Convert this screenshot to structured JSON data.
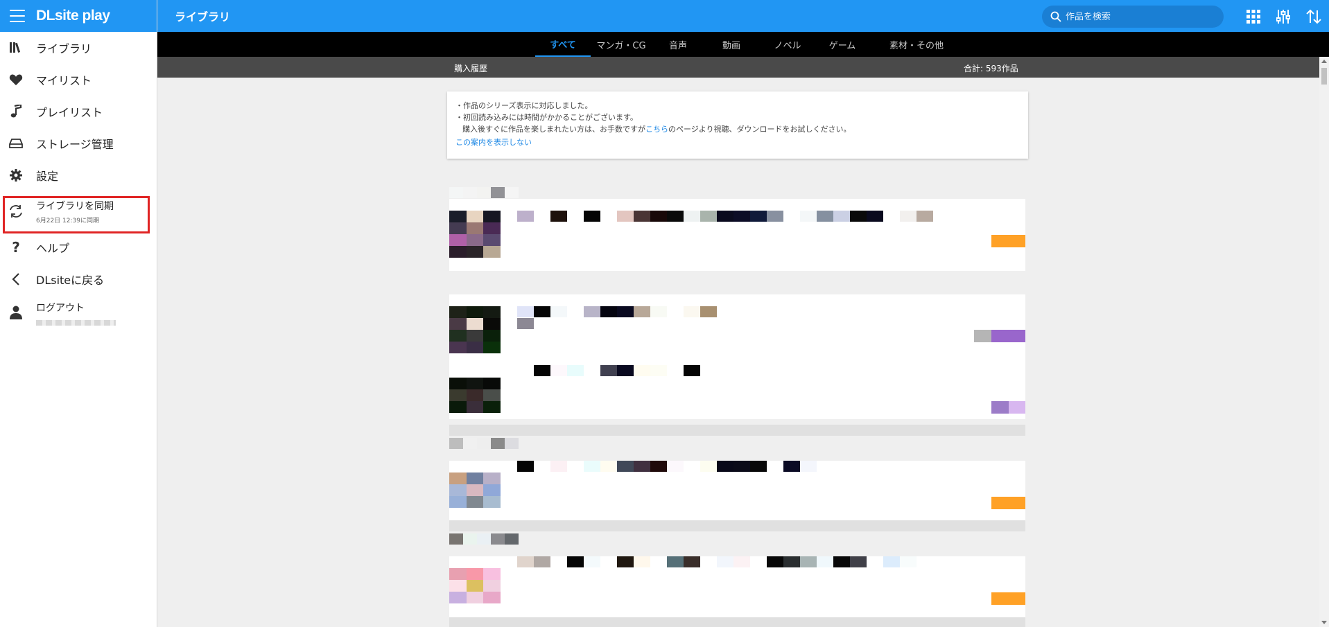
{
  "brand": {
    "logo": "DLsite play"
  },
  "header": {
    "title": "ライブラリ",
    "search_placeholder": "作品を検索"
  },
  "sidebar": {
    "items": [
      {
        "label": "ライブラリ",
        "icon": "library-icon"
      },
      {
        "label": "マイリスト",
        "icon": "heart-icon"
      },
      {
        "label": "プレイリスト",
        "icon": "music-note-icon"
      },
      {
        "label": "ストレージ管理",
        "icon": "storage-drive-icon"
      },
      {
        "label": "設定",
        "icon": "gear-icon"
      },
      {
        "label": "ライブラリを同期",
        "sublabel": "6月22日 12:39に同期",
        "icon": "sync-icon"
      },
      {
        "label": "ヘルプ",
        "icon": "question-icon"
      },
      {
        "label": "DLsiteに戻る",
        "icon": "chevron-left-icon"
      },
      {
        "label": "ログアウト",
        "icon": "user-icon"
      }
    ]
  },
  "tabs": [
    {
      "label": "すべて",
      "active": true
    },
    {
      "label": "マンガ・CG"
    },
    {
      "label": "音声"
    },
    {
      "label": "動画"
    },
    {
      "label": "ノベル"
    },
    {
      "label": "ゲーム"
    },
    {
      "label": "素材・その他"
    }
  ],
  "subbar": {
    "left": "購入履歴",
    "right": "合計: 593作品"
  },
  "notice": {
    "line1": "・作品のシリーズ表示に対応しました。",
    "line2": "・初回読み込みには時間がかかることがございます。",
    "line3_pre": "購入後すぐに作品を楽しまれたい方は、お手数ですが",
    "line3_link": "こちら",
    "line3_post": "のページより視聴、ダウンロードをお試しください。",
    "dismiss": "この案内を表示しない"
  },
  "colors": {
    "primary": "#2196f3",
    "highlight_box": "#e02424",
    "badge_orange": "#ffa126",
    "badge_purple": "#9966cc",
    "badge_lavender": "#d8b7f0"
  }
}
